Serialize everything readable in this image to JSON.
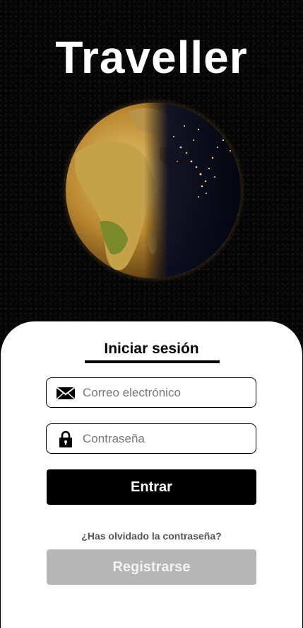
{
  "app": {
    "title": "Traveller"
  },
  "login": {
    "heading": "Iniciar sesión",
    "email": {
      "placeholder": "Correo electrónico",
      "icon": "envelope-icon"
    },
    "password": {
      "placeholder": "Contraseña",
      "icon": "lock-icon"
    },
    "submit_label": "Entrar",
    "forgot_label": "¿Has olvidado la contraseña?",
    "register_label": "Registrarse"
  },
  "colors": {
    "background": "#000000",
    "primary_button": "#000000",
    "secondary_button": "#b6b6b6",
    "card": "#ffffff"
  }
}
